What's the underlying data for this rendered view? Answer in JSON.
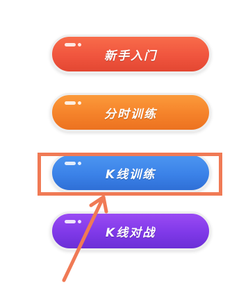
{
  "menu": {
    "beginner_label": "新手入门",
    "timeshare_label": "分时训练",
    "kline_training_label": "K线训练",
    "kline_battle_label": "K线对战"
  },
  "colors": {
    "highlight": "#f07a55",
    "beginner": "#f0553e",
    "timeshare": "#f5822a",
    "kline_training": "#3b82e8",
    "kline_battle": "#7f39e8"
  }
}
